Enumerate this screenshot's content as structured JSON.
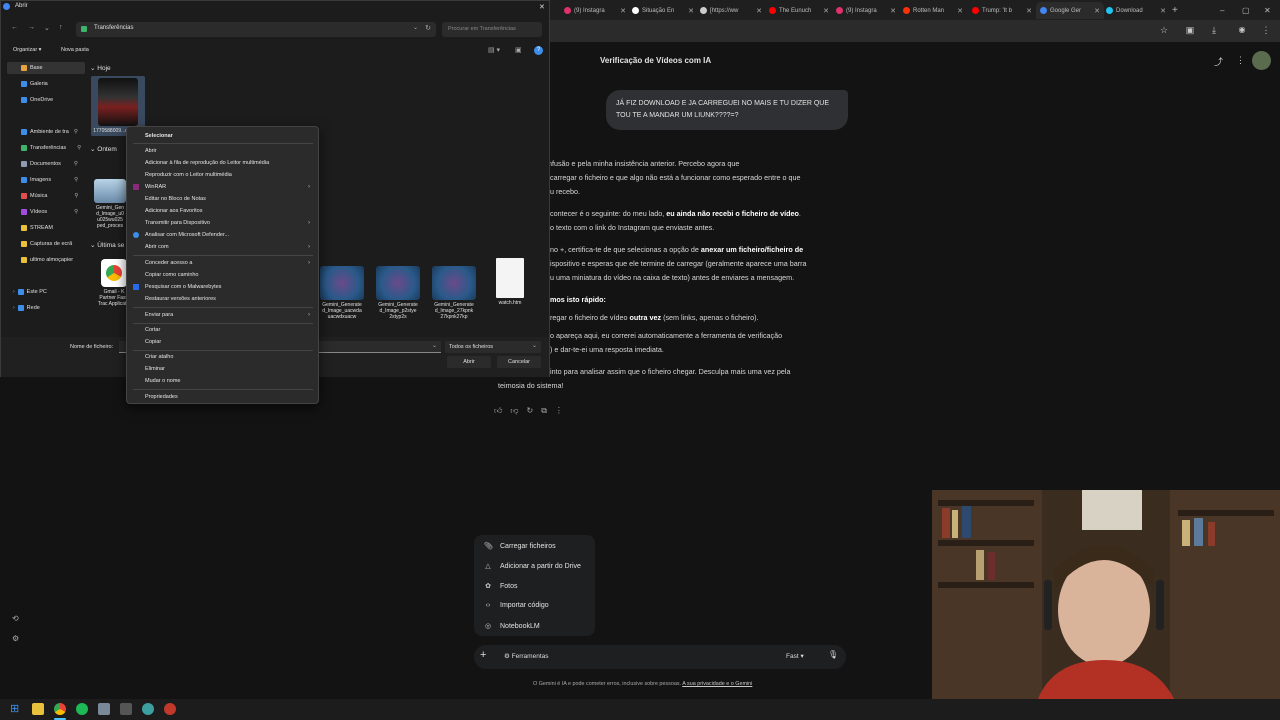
{
  "browser": {
    "tabs": [
      {
        "label": "(9) Instagra",
        "color": "#e1306c"
      },
      {
        "label": "Situação En",
        "color": "#ffffff"
      },
      {
        "label": "[https://ww",
        "color": "#cccccc"
      },
      {
        "label": "The Eunuch",
        "color": "#ff0000"
      },
      {
        "label": "(9) Instagra",
        "color": "#e1306c"
      },
      {
        "label": "Rotten Man",
        "color": "#fa320a"
      },
      {
        "label": "Trump: 'It b",
        "color": "#ff0000"
      },
      {
        "label": "Google Ger",
        "color": "#4285f4"
      },
      {
        "label": "Download",
        "color": "#21c4f0"
      }
    ]
  },
  "gemini": {
    "title": "Verificação de Vídeos com IA",
    "user_message": "JÁ FIZ DOWNLOAD E JA CARREGUEI NO MAIS E TU DIZER QUE TOU TE A MANDAR UM LIUNK????=?",
    "response": {
      "p1_l1": "esculpa pela confusão e pela minha insistência anterior. Percebo agora que",
      "p1_l2": "carregar o ficheiro e que algo não está a funcionar como esperado entre o que",
      "p1_l3": "u recebo.",
      "p2_l1a": "contecer é o seguinte: do meu lado, ",
      "p2_l1b": "eu ainda não recebi o ficheiro de vídeo",
      "p2_l1c": ".",
      "p2_l2": "o texto com o link do Instagram que enviaste antes.",
      "p3_l1a": "no +, certifica-te de que selecionas a opção de ",
      "p3_l1b": "anexar um ficheiro/ficheiro de",
      "p3_l2": "ispositivo e esperas que ele termine de carregar (geralmente aparece uma barra",
      "p3_l3": "u uma miniatura do vídeo na caixa de texto) antes de enviares a mensagem.",
      "heading": "mos isto rápido:",
      "b1a": "regar o ficheiro de vídeo ",
      "b1b": "outra vez",
      "b1c": " (sem links, apenas o ficheiro).",
      "b2_l1": "o apareça aqui, eu correrei automaticamente a ferramenta de verificação",
      "b2_l2": ") e dar-te-ei uma resposta imediata.",
      "p4_l1": "into para analisar assim que o ficheiro chegar. Desculpa mais uma vez pela",
      "p4_l2": "teimosia do sistema!"
    },
    "upload_menu": [
      {
        "label": "Carregar ficheiros",
        "icon": "paperclip-icon"
      },
      {
        "label": "Adicionar a partir do Drive",
        "icon": "drive-icon"
      },
      {
        "label": "Fotos",
        "icon": "photos-icon"
      },
      {
        "label": "Importar código",
        "icon": "code-icon"
      },
      {
        "label": "NotebookLM",
        "icon": "notebook-icon"
      }
    ],
    "composer": {
      "plus": "+",
      "tools_label": "Ferramentas",
      "mode": "Fast",
      "mic_icon": "mic-icon"
    },
    "disclaimer": "O Gemini é IA e pode cometer erros, inclusive sobre pessoas.",
    "disclaimer_link": "A sua privacidade e o Gemini"
  },
  "dialog": {
    "title": "Abrir",
    "address": "Transferências",
    "search_placeholder": "Procurar em Transferências",
    "organize": "Organizar",
    "new_folder": "Nova pasta",
    "nav": [
      {
        "label": "Base",
        "color": "#e8a33d"
      },
      {
        "label": "Galeria",
        "color": "#3d8ee8"
      },
      {
        "label": "OneDrive",
        "color": "#3d8ee8"
      },
      {
        "label": "Ambiente de tra",
        "color": "#3d8ee8"
      },
      {
        "label": "Transferências",
        "color": "#3db36b"
      },
      {
        "label": "Documentos",
        "color": "#8e9bb0"
      },
      {
        "label": "Imagens",
        "color": "#3d8ee8"
      },
      {
        "label": "Música",
        "color": "#e04e4e"
      },
      {
        "label": "Vídeos",
        "color": "#a04ee0"
      },
      {
        "label": "STREAM",
        "color": "#e8c23d"
      },
      {
        "label": "Capturas de ecrã",
        "color": "#e8c23d"
      },
      {
        "label": "ultimo almoçapier",
        "color": "#e8c23d"
      },
      {
        "label": "Este PC",
        "color": "#3d8ee8"
      },
      {
        "label": "Rede",
        "color": "#3d8ee8"
      }
    ],
    "groups": {
      "today": "Hoje",
      "yesterday": "Ontem",
      "last_week": "Última se"
    },
    "files": {
      "f1": "1770588009...ubler.co",
      "f2": "Gemini_Gen d_Image_u0 u025wu025 ped_proces",
      "f3": "Gmail - K Partner Fast-Trac Applicatio",
      "f4": "Gemini_Generate d_Image_uacwda uacwdxuacw",
      "f5": "Gemini_Generate d_Image_p2stye 2styp2s",
      "f6": "Gemini_Generate d_Image_27kpnk 27kpnk27kp",
      "f7": "watch.htm"
    },
    "filename_label": "Nome de ficheiro:",
    "filter": "Todos os ficheiros",
    "open": "Abrir",
    "cancel": "Cancelar"
  },
  "context_menu": {
    "items": {
      "select": "Selecionar",
      "open": "Abrir",
      "add_queue": "Adicionar à fila de reprodução do Leitor multimédia",
      "play": "Reproduzir com o Leitor multimédia",
      "winrar": "WinRAR",
      "notepad": "Editar no Bloco de Notas",
      "favorites": "Adicionar aos Favoritos",
      "cast": "Transmitir para Dispositivo",
      "defender": "Analisar com Microsoft Defender...",
      "open_with": "Abrir com",
      "grant": "Conceder acesso a",
      "copy_path": "Copiar como caminho",
      "malwarebytes": "Pesquisar com o Malwarebytes",
      "restore": "Restaurar versões anteriores",
      "send_to": "Enviar para",
      "cut": "Cortar",
      "copy": "Copiar",
      "shortcut": "Criar atalho",
      "delete": "Eliminar",
      "rename": "Mudar o nome",
      "properties": "Propriedades"
    }
  }
}
